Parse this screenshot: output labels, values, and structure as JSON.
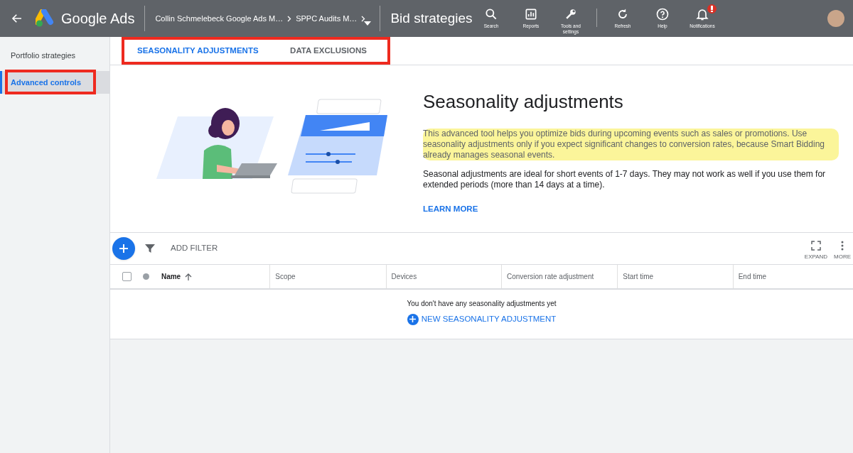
{
  "header": {
    "product": "Google Ads",
    "breadcrumbs": [
      "Collin Schmelebeck Google Ads M…",
      "SPPC Audits M…"
    ],
    "page_title": "Bid strategies",
    "actions": [
      {
        "kind": "search",
        "label": "Search",
        "alert": false
      },
      {
        "kind": "reports",
        "label": "Reports",
        "alert": false
      },
      {
        "kind": "tools",
        "label": "Tools and settings",
        "alert": false
      },
      {
        "kind": "refresh",
        "label": "Refresh",
        "alert": false
      },
      {
        "kind": "help",
        "label": "Help",
        "alert": false
      },
      {
        "kind": "notifications",
        "label": "Notifications",
        "alert": true
      }
    ]
  },
  "sidebar": {
    "items": [
      {
        "label": "Portfolio strategies",
        "selected": false,
        "outlined": false
      },
      {
        "label": "Advanced controls",
        "selected": true,
        "outlined": true
      }
    ]
  },
  "tabs": {
    "outlined": true,
    "items": [
      {
        "label": "SEASONALITY ADJUSTMENTS",
        "selected": true
      },
      {
        "label": "DATA EXCLUSIONS",
        "selected": false
      }
    ]
  },
  "intro": {
    "title": "Seasonality adjustments",
    "paragraphs": [
      {
        "text": "This advanced tool helps you optimize bids during upcoming events such as sales or promotions. Use seasonality adjustments only if you expect significant changes to conversion rates, because Smart Bidding already manages seasonal events.",
        "highlighted": true
      },
      {
        "text": "Seasonal adjustments are ideal for short events of 1-7 days. They may not work as well if you use them for extended periods (more than 14 days at a time).",
        "highlighted": false
      }
    ],
    "link": "LEARN MORE"
  },
  "toolbar": {
    "filter": "ADD FILTER",
    "actions": [
      {
        "kind": "expand",
        "label": "EXPAND"
      },
      {
        "kind": "more",
        "label": "MORE"
      }
    ]
  },
  "table": {
    "select_all_checked": false,
    "columns": [
      {
        "label": "Name",
        "sorted": true
      },
      {
        "label": "Scope",
        "sorted": false
      },
      {
        "label": "Devices",
        "sorted": false
      },
      {
        "label": "Conversion rate adjustment",
        "sorted": false
      },
      {
        "label": "Start time",
        "sorted": false
      },
      {
        "label": "End time",
        "sorted": false
      }
    ],
    "empty_message": "You don't have any seasonality adjustments yet",
    "new_button": "NEW SEASONALITY ADJUSTMENT"
  }
}
